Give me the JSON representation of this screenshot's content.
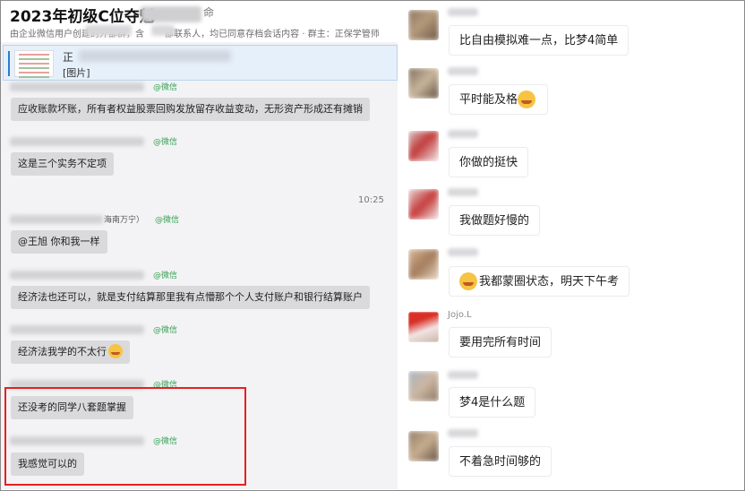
{
  "header": {
    "title": "2023年初级C位夺魁",
    "title_mark": "命",
    "subtitle": "由企业微信用户创建的外部群，含 　　部联系人，均已同意存档会话内容 · 群主：正保学管师"
  },
  "quoted": {
    "name": "正",
    "text": "[图片]"
  },
  "left_messages": [
    {
      "tag": "@微信",
      "text": "应收账款坏账，所有者权益股票回购发放留存收益变动，无形资产形成还有摊销"
    },
    {
      "tag": "@微信",
      "text": "这是三个实务不定项"
    },
    {
      "sender_extra": "海南万宁）",
      "tag": "@微信",
      "text": "@王旭  你和我一样"
    },
    {
      "tag": "@微信",
      "text": "经济法也还可以，就是支付结算那里我有点懵那个个人支付账户和银行结算账户"
    },
    {
      "tag": "@微信",
      "text": "经济法我学的不太行"
    },
    {
      "tag": "@微信",
      "text": "还没考的同学八套题掌握"
    },
    {
      "tag": "@微信",
      "text": "我感觉可以的"
    }
  ],
  "time_label": "10:25",
  "right_messages": [
    {
      "name": "",
      "text": "比自由模拟难一点，比梦4简单"
    },
    {
      "name": "",
      "text": "平时能及格"
    },
    {
      "name": "",
      "text": "你做的挺快"
    },
    {
      "name": "",
      "text": "我做题好慢的"
    },
    {
      "name": "",
      "text": "我都蒙圈状态，明天下午考"
    },
    {
      "name": "Jojo.L",
      "text": "要用完所有时间"
    },
    {
      "name": "",
      "text": "梦4是什么题"
    },
    {
      "name": "",
      "text": "不着急时间够的"
    }
  ],
  "icons": {
    "laugh": "laughing-emoji-icon",
    "wechat_tag": "wechat-source-tag"
  },
  "colors": {
    "accent": "#2a7ad8",
    "wechat_green": "#3aa157",
    "highlight_box": "#e52020",
    "bubble_left": "#dadadd",
    "panel_left": "#f3f3f5"
  }
}
